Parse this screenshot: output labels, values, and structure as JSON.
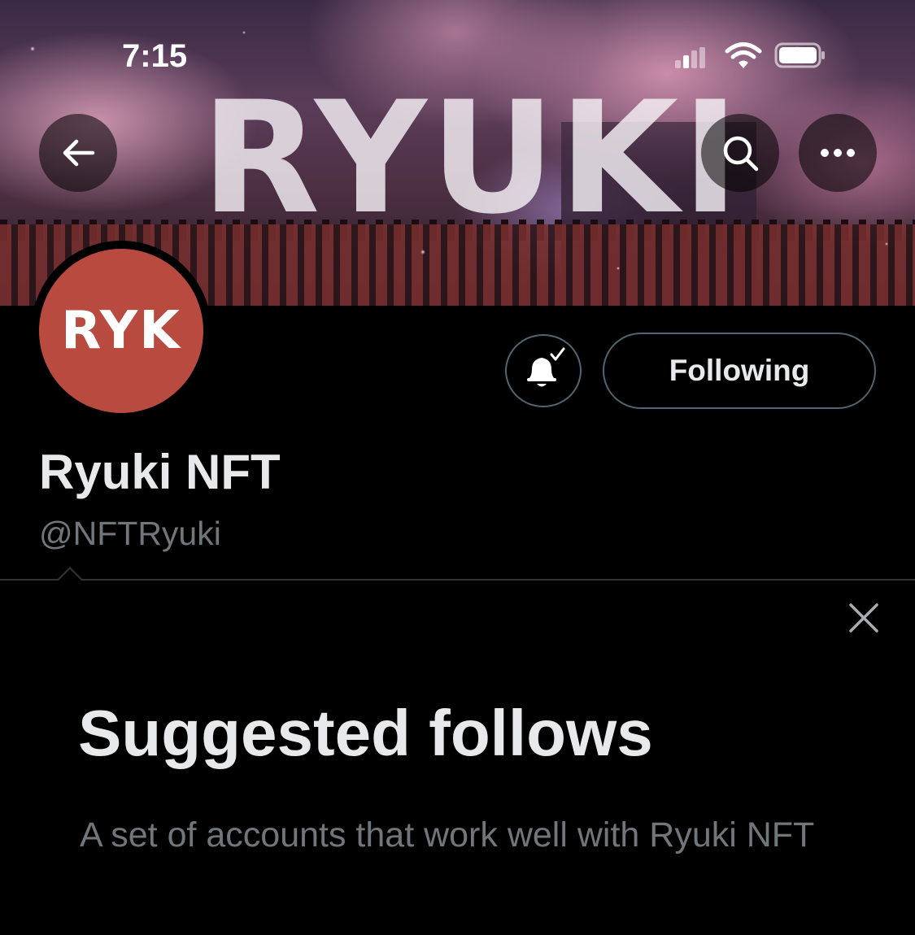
{
  "status_bar": {
    "time": "7:15",
    "signal_icon": "cellular-signal-icon",
    "wifi_icon": "wifi-icon",
    "battery_icon": "battery-icon"
  },
  "banner": {
    "title_text": "Ryuki",
    "back_icon": "arrow-left-icon",
    "search_icon": "search-icon",
    "more_icon": "more-horizontal-icon"
  },
  "profile": {
    "avatar_text": "RYK",
    "avatar_color": "#b84a3f",
    "notification_icon": "bell-check-icon",
    "follow_button_label": "Following",
    "display_name": "Ryuki NFT",
    "handle": "@NFTRyuki"
  },
  "suggested": {
    "close_icon": "close-icon",
    "title": "Suggested follows",
    "description": "A set of accounts that work well with Ryuki NFT"
  },
  "colors": {
    "background": "#000000",
    "primary_text": "#e7e9ea",
    "secondary_text": "#71767b",
    "border": "#536471",
    "divider": "#2f3336"
  }
}
